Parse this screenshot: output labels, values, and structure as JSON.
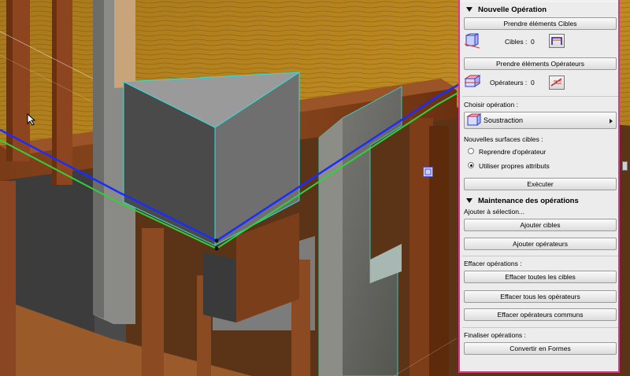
{
  "colors": {
    "accent": "#e0358c",
    "panel_bg": "#ececec",
    "beam_blue": "#1a2cff",
    "beam_green": "#2fd23a"
  },
  "palette": {
    "new_op": {
      "title": "Nouvelle Opération",
      "take_targets_label": "Prendre éléments Cibles",
      "targets_label": "Cibles :",
      "targets_count": "0",
      "take_operators_label": "Prendre éléments Opérateurs",
      "operators_label": "Opérateurs :",
      "operators_count": "0",
      "choose_op_label": "Choisir opération :",
      "operation_value": "Soustraction",
      "new_surfaces_label": "Nouvelles surfaces cibles :",
      "radio_operator": "Reprendre d'opérateur",
      "radio_own": "Utiliser propres attributs",
      "execute_label": "Exécuter"
    },
    "maintenance": {
      "title": "Maintenance des opérations",
      "add_to_selection": "Ajouter à sélection...",
      "add_targets": "Ajouter cibles",
      "add_operators": "Ajouter opérateurs",
      "delete_ops_label": "Effacer opérations :",
      "delete_all_targets": "Effacer toutes les cibles",
      "delete_all_operators": "Effacer tous les opérateurs",
      "delete_common_operators": "Effacer opérateurs communs",
      "finalize_label": "Finaliser opérations :",
      "convert_to_shapes": "Convertir en Formes"
    }
  },
  "icons": {
    "targets_icon": "solid-target-icon",
    "targets_pick": "pick-target-icon",
    "operators_icon": "solid-operator-icon",
    "operators_pick": "pick-operator-icon",
    "operation_icon": "subtraction-icon",
    "cursor": "arrow-cursor-icon",
    "snap": "snap-point-icon"
  }
}
